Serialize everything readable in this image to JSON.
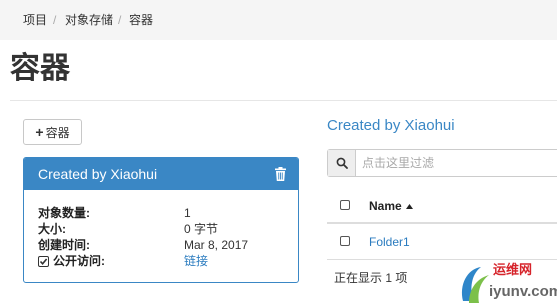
{
  "breadcrumb": {
    "items": [
      "项目",
      "对象存储",
      "容器"
    ],
    "separator": "/"
  },
  "page": {
    "title": "容器"
  },
  "toolbar": {
    "add_container_icon": "+",
    "add_container_label": "容器"
  },
  "container_panel": {
    "title": "Created by Xiaohui",
    "delete_icon": "trash-icon",
    "rows": [
      {
        "label": "对象数量:",
        "value": "1"
      },
      {
        "label": "大小:",
        "value": "0 字节"
      },
      {
        "label": "创建时间:",
        "value": "Mar 8, 2017"
      },
      {
        "label": "公开访问:",
        "value": "链接",
        "icon": "checkbox-checked-icon"
      }
    ]
  },
  "objects": {
    "title": "Created by Xiaohui",
    "search": {
      "icon": "search-icon",
      "placeholder": "点击这里过滤"
    },
    "table": {
      "columns": [
        "Name"
      ],
      "sort_icon": "caret-up-icon",
      "rows": [
        {
          "name": "Folder1"
        }
      ]
    },
    "footer": "正在显示 1 项"
  },
  "watermark": {
    "cn": "运维网",
    "en": "iyunv.com"
  },
  "colors": {
    "accent": "#3a87c5",
    "link": "#2a7bbf",
    "watermark_red": "#d6232a"
  }
}
